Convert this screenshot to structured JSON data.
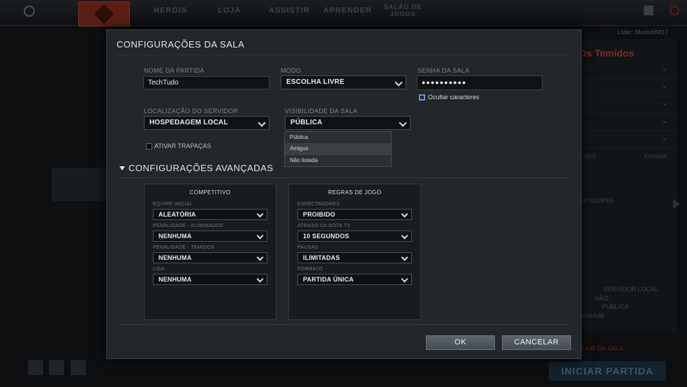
{
  "background": {
    "nav": [
      "HERÓIS",
      "LOJA",
      "ASSISTIR",
      "APRENDER"
    ],
    "nav_small": "SALÃO DE JOGOS",
    "leader": "Líder: MurloMM17",
    "right_title": "Os Temidos",
    "tores": "TORES",
    "entrar": "ENTRAR",
    "eqp": "AR EQUIPES",
    "info": [
      "SERVIDOR LOCAL",
      "NÃO",
      "PÚBLICA",
      "NENHUM"
    ],
    "sair": "SAIR DA SALA",
    "iniciar": "INICIAR PARTIDA"
  },
  "modal": {
    "title": "CONFIGURAÇÕES DA SALA",
    "name_label": "NOME DA PARTIDA",
    "name_value": "TechTudo",
    "mode_label": "MODO",
    "mode_value": "ESCOLHA LIVRE",
    "password_label": "SENHA DA SALA",
    "password_value": "●●●●●●●●●●",
    "hide_chars_label": "Ocultar caracteres",
    "server_label": "LOCALIZAÇÃO DO SERVIDOR",
    "server_value": "HOSPEDAGEM LOCAL",
    "visibility_label": "VISIBILIDADE DA SALA",
    "visibility_value": "PÚBLICA",
    "visibility_options": [
      "Pública",
      "Amigos",
      "Não listada"
    ],
    "cheats_label": "ATIVAR TRAPAÇAS",
    "advanced_title": "CONFIGURAÇÕES AVANÇADAS",
    "competitive": {
      "title": "COMPETITIVO",
      "fields": [
        {
          "label": "EQUIPE INICIAL",
          "value": "ALEATÓRIA"
        },
        {
          "label": "PENALIDADE - ILUMINADOS",
          "value": "NENHUMA"
        },
        {
          "label": "PENALIDADE - TEMIDOS",
          "value": "NENHUMA"
        },
        {
          "label": "LIGA",
          "value": "NENHUMA"
        }
      ]
    },
    "rules": {
      "title": "REGRAS DE JOGO",
      "fields": [
        {
          "label": "ESPECTADORES",
          "value": "PROIBIDO"
        },
        {
          "label": "ATRASO DA DOTA TV",
          "value": "10 SEGUNDOS"
        },
        {
          "label": "PAUSAS",
          "value": "ILIMITADAS"
        },
        {
          "label": "FORMATO",
          "value": "PARTIDA ÚNICA"
        }
      ]
    },
    "ok_label": "OK",
    "cancel_label": "CANCELAR"
  }
}
